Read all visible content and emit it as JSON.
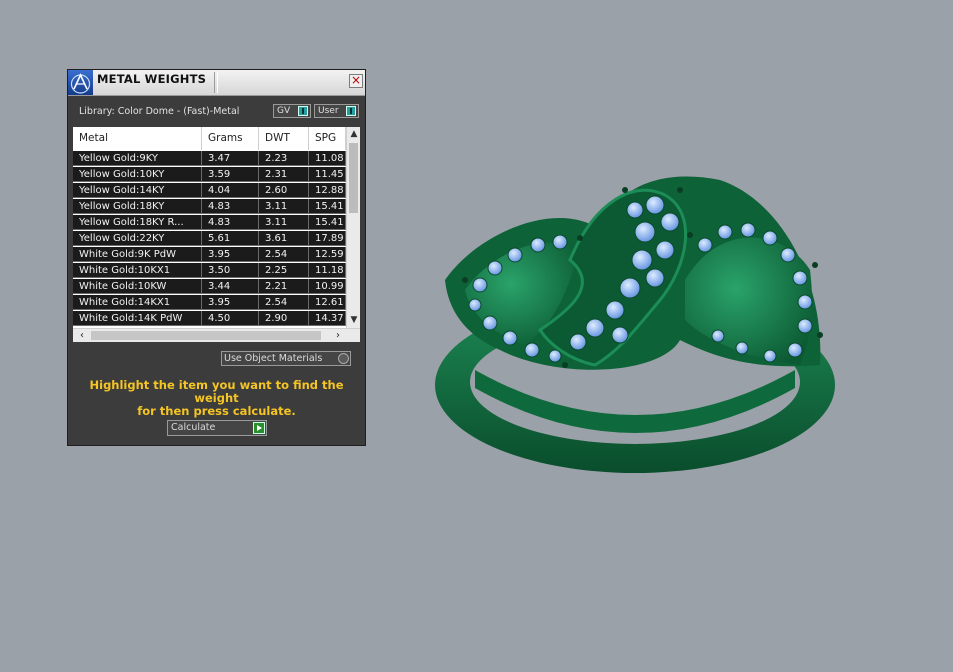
{
  "window": {
    "title": "METAL WEIGHTS",
    "close_icon": "close-icon"
  },
  "library": {
    "label": "Library: Color Dome - (Fast)-Metal",
    "gv_label": "GV",
    "user_label": "User"
  },
  "table": {
    "columns": [
      "Metal",
      "Grams",
      "DWT",
      "SPG"
    ],
    "rows": [
      [
        "Yellow Gold:9KY",
        "3.47",
        "2.23",
        "11.08"
      ],
      [
        "Yellow Gold:10KY",
        "3.59",
        "2.31",
        "11.45"
      ],
      [
        "Yellow Gold:14KY",
        "4.04",
        "2.60",
        "12.88"
      ],
      [
        "Yellow Gold:18KY",
        "4.83",
        "3.11",
        "15.41"
      ],
      [
        "Yellow Gold:18KY R...",
        "4.83",
        "3.11",
        "15.41"
      ],
      [
        "Yellow Gold:22KY",
        "5.61",
        "3.61",
        "17.89"
      ],
      [
        "White Gold:9K PdW",
        "3.95",
        "2.54",
        "12.59"
      ],
      [
        "White Gold:10KX1",
        "3.50",
        "2.25",
        "11.18"
      ],
      [
        "White Gold:10KW",
        "3.44",
        "2.21",
        "10.99"
      ],
      [
        "White Gold:14KX1",
        "3.95",
        "2.54",
        "12.61"
      ],
      [
        "White Gold:14K PdW",
        "4.50",
        "2.90",
        "14.37"
      ]
    ]
  },
  "controls": {
    "use_object_materials": "Use Object Materials",
    "hint_line1": "Highlight the item you want to find the weight",
    "hint_line2": "for then press calculate.",
    "calculate": "Calculate"
  },
  "colors": {
    "background": "#9aa1a8",
    "panel": "#3c3c3c",
    "hint_text": "#f5c524",
    "ring_metal": "#0f6b3f",
    "gem": "#7fb0ff"
  }
}
